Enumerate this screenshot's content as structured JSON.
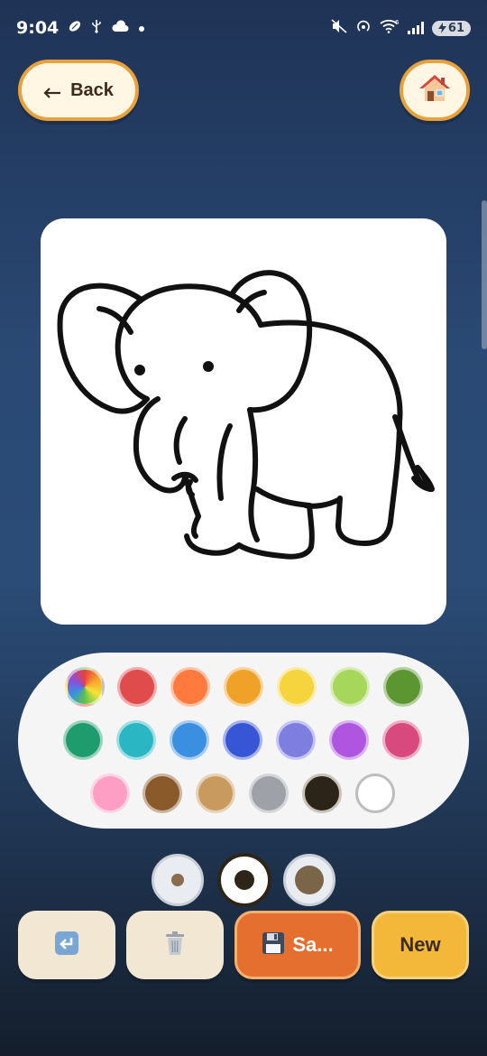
{
  "status_bar": {
    "time": "9:04",
    "battery": "61"
  },
  "header": {
    "back_label": "Back",
    "back_icon": "left-arrow-icon",
    "home_icon": "house-icon"
  },
  "canvas": {
    "image": "elephant-outline"
  },
  "palette": {
    "colors": [
      {
        "name": "rainbow",
        "hex": "rainbow"
      },
      {
        "name": "red",
        "hex": "#e04b4b"
      },
      {
        "name": "orange",
        "hex": "#ff7a3c"
      },
      {
        "name": "amber",
        "hex": "#f0a228"
      },
      {
        "name": "yellow",
        "hex": "#f6d43e"
      },
      {
        "name": "light-green",
        "hex": "#a6d65a"
      },
      {
        "name": "green",
        "hex": "#5c9630"
      },
      {
        "name": "teal-green",
        "hex": "#1f9c6e"
      },
      {
        "name": "cyan",
        "hex": "#2bb6c3"
      },
      {
        "name": "sky-blue",
        "hex": "#3a8fe0"
      },
      {
        "name": "blue",
        "hex": "#3756d6"
      },
      {
        "name": "lavender",
        "hex": "#7e7ee0"
      },
      {
        "name": "purple",
        "hex": "#b055e0"
      },
      {
        "name": "pink-red",
        "hex": "#d84a7e"
      },
      {
        "name": "pink",
        "hex": "#ff9ec4"
      },
      {
        "name": "brown",
        "hex": "#8b5a2b"
      },
      {
        "name": "tan",
        "hex": "#c99a5e"
      },
      {
        "name": "gray",
        "hex": "#9ea2a8"
      },
      {
        "name": "black",
        "hex": "#2c2418"
      },
      {
        "name": "white",
        "hex": "#ffffff"
      }
    ],
    "selected": "black"
  },
  "brush_sizes": {
    "options": [
      "small",
      "medium",
      "large"
    ],
    "selected": "medium"
  },
  "actions": {
    "undo_icon": "undo-arrow-icon",
    "clear_icon": "trash-icon",
    "save_icon": "floppy-disk-icon",
    "save_label": "Sa...",
    "new_label": "New"
  },
  "colors": {
    "accent_orange": "#e46f2f",
    "accent_yellow": "#f3b83a",
    "button_cream": "#f2e7d2",
    "border_gold": "#e9a23b"
  }
}
